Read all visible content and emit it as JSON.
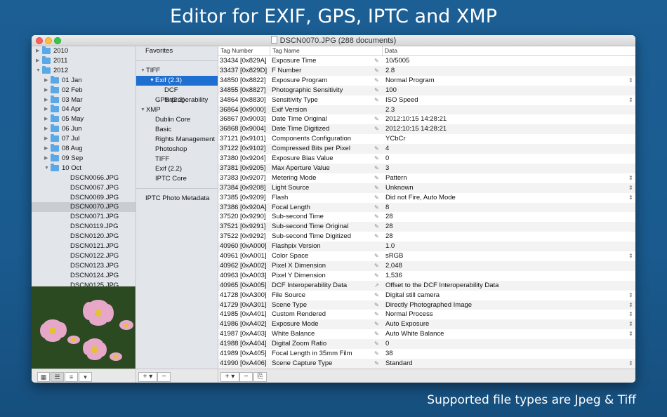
{
  "headline": "Editor for EXIF, GPS, IPTC and XMP",
  "footer": "Supported file types are Jpeg & Tiff",
  "window": {
    "title": "DSCN0070.JPG (288 documents)"
  },
  "folders": [
    {
      "label": "2010",
      "level": 0,
      "expanded": false,
      "folder": true
    },
    {
      "label": "2011",
      "level": 0,
      "expanded": false,
      "folder": true
    },
    {
      "label": "2012",
      "level": 0,
      "expanded": true,
      "folder": true
    },
    {
      "label": "01 Jan",
      "level": 1,
      "expanded": false,
      "folder": true
    },
    {
      "label": "02 Feb",
      "level": 1,
      "expanded": false,
      "folder": true
    },
    {
      "label": "03 Mar",
      "level": 1,
      "expanded": false,
      "folder": true
    },
    {
      "label": "04 Apr",
      "level": 1,
      "expanded": false,
      "folder": true
    },
    {
      "label": "05 May",
      "level": 1,
      "expanded": false,
      "folder": true
    },
    {
      "label": "06 Jun",
      "level": 1,
      "expanded": false,
      "folder": true
    },
    {
      "label": "07 Jul",
      "level": 1,
      "expanded": false,
      "folder": true
    },
    {
      "label": "08 Aug",
      "level": 1,
      "expanded": false,
      "folder": true
    },
    {
      "label": "09 Sep",
      "level": 1,
      "expanded": false,
      "folder": true
    },
    {
      "label": "10 Oct",
      "level": 1,
      "expanded": true,
      "folder": true
    },
    {
      "label": "DSCN0066.JPG",
      "level": 2,
      "folder": false
    },
    {
      "label": "DSCN0067.JPG",
      "level": 2,
      "folder": false
    },
    {
      "label": "DSCN0069.JPG",
      "level": 2,
      "folder": false
    },
    {
      "label": "DSCN0070.JPG",
      "level": 2,
      "folder": false,
      "selected": true
    },
    {
      "label": "DSCN0071.JPG",
      "level": 2,
      "folder": false
    },
    {
      "label": "DSCN0119.JPG",
      "level": 2,
      "folder": false
    },
    {
      "label": "DSCN0120.JPG",
      "level": 2,
      "folder": false
    },
    {
      "label": "DSCN0121.JPG",
      "level": 2,
      "folder": false
    },
    {
      "label": "DSCN0122.JPG",
      "level": 2,
      "folder": false
    },
    {
      "label": "DSCN0123.JPG",
      "level": 2,
      "folder": false
    },
    {
      "label": "DSCN0124.JPG",
      "level": 2,
      "folder": false
    },
    {
      "label": "DSCN0125.JPG",
      "level": 2,
      "folder": false
    }
  ],
  "view_modes": [
    "icon-grid-view",
    "column-view",
    "list-view",
    "dropdown-menu"
  ],
  "groups": [
    {
      "label": "Favorites",
      "level": 0,
      "triangle": false
    },
    {
      "label": "",
      "separator": true
    },
    {
      "label": "TIFF",
      "level": 0,
      "triangle": "down"
    },
    {
      "label": "Exif (2.3)",
      "level": 1,
      "triangle": "down",
      "selected": true
    },
    {
      "label": "DCF Interoperability",
      "level": 2,
      "triangle": false
    },
    {
      "label": "GPS (2.3)",
      "level": 1,
      "triangle": false
    },
    {
      "label": "XMP",
      "level": 0,
      "triangle": "down"
    },
    {
      "label": "Dublin Core",
      "level": 1,
      "triangle": false
    },
    {
      "label": "Basic",
      "level": 1,
      "triangle": false
    },
    {
      "label": "Rights Management",
      "level": 1,
      "triangle": false
    },
    {
      "label": "Photoshop",
      "level": 1,
      "triangle": false
    },
    {
      "label": "TIFF",
      "level": 1,
      "triangle": false
    },
    {
      "label": "Exif (2.2)",
      "level": 1,
      "triangle": false
    },
    {
      "label": "IPTC Core",
      "level": 1,
      "triangle": false
    },
    {
      "label": "",
      "separator": true
    },
    {
      "label": "IPTC Photo Metadata",
      "level": 0,
      "triangle": false
    }
  ],
  "table": {
    "headers": [
      "Tag Number",
      "Tag Name",
      "Data"
    ],
    "rows": [
      {
        "num": "33434 [0x829A]",
        "name": "Exposure Time",
        "data": "10/5005",
        "edit": true,
        "popup": false
      },
      {
        "num": "33437 [0x829D]",
        "name": "F Number",
        "data": "2.8",
        "edit": true,
        "popup": false
      },
      {
        "num": "34850 [0x8822]",
        "name": "Exposure Program",
        "data": "Normal Program",
        "edit": true,
        "popup": true
      },
      {
        "num": "34855 [0x8827]",
        "name": "Photographic Sensitivity",
        "data": "100",
        "edit": true,
        "popup": false
      },
      {
        "num": "34864 [0x8830]",
        "name": "Sensitivity Type",
        "data": "ISO Speed",
        "edit": true,
        "popup": true
      },
      {
        "num": "36864 [0x9000]",
        "name": "Exif Version",
        "data": "2.3",
        "edit": false,
        "popup": false
      },
      {
        "num": "36867 [0x9003]",
        "name": "Date Time Original",
        "data": "2012:10:15 14:28:21",
        "edit": true,
        "popup": false
      },
      {
        "num": "36868 [0x9004]",
        "name": "Date Time Digitized",
        "data": "2012:10:15 14:28:21",
        "edit": true,
        "popup": false
      },
      {
        "num": "37121 [0x9101]",
        "name": "Components Configuration",
        "data": "YCbCr",
        "edit": false,
        "popup": false
      },
      {
        "num": "37122 [0x9102]",
        "name": "Compressed Bits per Pixel",
        "data": "4",
        "edit": true,
        "popup": false
      },
      {
        "num": "37380 [0x9204]",
        "name": "Exposure Bias Value",
        "data": "0",
        "edit": true,
        "popup": false
      },
      {
        "num": "37381 [0x9205]",
        "name": "Max Aperture Value",
        "data": "3",
        "edit": true,
        "popup": false
      },
      {
        "num": "37383 [0x9207]",
        "name": "Metering Mode",
        "data": "Pattern",
        "edit": true,
        "popup": true
      },
      {
        "num": "37384 [0x9208]",
        "name": "Light Source",
        "data": "Unknown",
        "edit": true,
        "popup": true
      },
      {
        "num": "37385 [0x9209]",
        "name": "Flash",
        "data": "Did not Fire, Auto Mode",
        "edit": true,
        "popup": true
      },
      {
        "num": "37386 [0x920A]",
        "name": "Focal Length",
        "data": "8",
        "edit": true,
        "popup": false
      },
      {
        "num": "37520 [0x9290]",
        "name": "Sub-second Time",
        "data": "28",
        "edit": true,
        "popup": false
      },
      {
        "num": "37521 [0x9291]",
        "name": "Sub-second Time Original",
        "data": "28",
        "edit": true,
        "popup": false
      },
      {
        "num": "37522 [0x9292]",
        "name": "Sub-second Time Digitized",
        "data": "28",
        "edit": true,
        "popup": false
      },
      {
        "num": "40960 [0xA000]",
        "name": "Flashpix Version",
        "data": "1.0",
        "edit": false,
        "popup": false
      },
      {
        "num": "40961 [0xA001]",
        "name": "Color Space",
        "data": "sRGB",
        "edit": true,
        "popup": true
      },
      {
        "num": "40962 [0xA002]",
        "name": "Pixel X Dimension",
        "data": "2,048",
        "edit": true,
        "popup": false
      },
      {
        "num": "40963 [0xA003]",
        "name": "Pixel Y Dimension",
        "data": "1,536",
        "edit": true,
        "popup": false
      },
      {
        "num": "40965 [0xA005]",
        "name": "DCF Interoperability Data",
        "data": "Offset to the DCF Interoperability Data",
        "edit": "link",
        "popup": false
      },
      {
        "num": "41728 [0xA300]",
        "name": "File Source",
        "data": "Digital still camera",
        "edit": true,
        "popup": true
      },
      {
        "num": "41729 [0xA301]",
        "name": "Scene Type",
        "data": "Directly Photographed Image",
        "edit": true,
        "popup": true
      },
      {
        "num": "41985 [0xA401]",
        "name": "Custom Rendered",
        "data": "Normal Process",
        "edit": true,
        "popup": true
      },
      {
        "num": "41986 [0xA402]",
        "name": "Exposure Mode",
        "data": "Auto Exposure",
        "edit": true,
        "popup": true
      },
      {
        "num": "41987 [0xA403]",
        "name": "White Balance",
        "data": "Auto White Balance",
        "edit": true,
        "popup": true
      },
      {
        "num": "41988 [0xA404]",
        "name": "Digital Zoom Ratio",
        "data": "0",
        "edit": true,
        "popup": false
      },
      {
        "num": "41989 [0xA405]",
        "name": "Focal Length in 35mm Film",
        "data": "38",
        "edit": true,
        "popup": false
      },
      {
        "num": "41990 [0xA406]",
        "name": "Scene Capture Type",
        "data": "Standard",
        "edit": true,
        "popup": true
      }
    ]
  },
  "colors": {
    "background": "#1b5c92",
    "selection": "#1f6fd1",
    "sidebar": "#e2e6eb",
    "folder": "#5aa9e6"
  }
}
